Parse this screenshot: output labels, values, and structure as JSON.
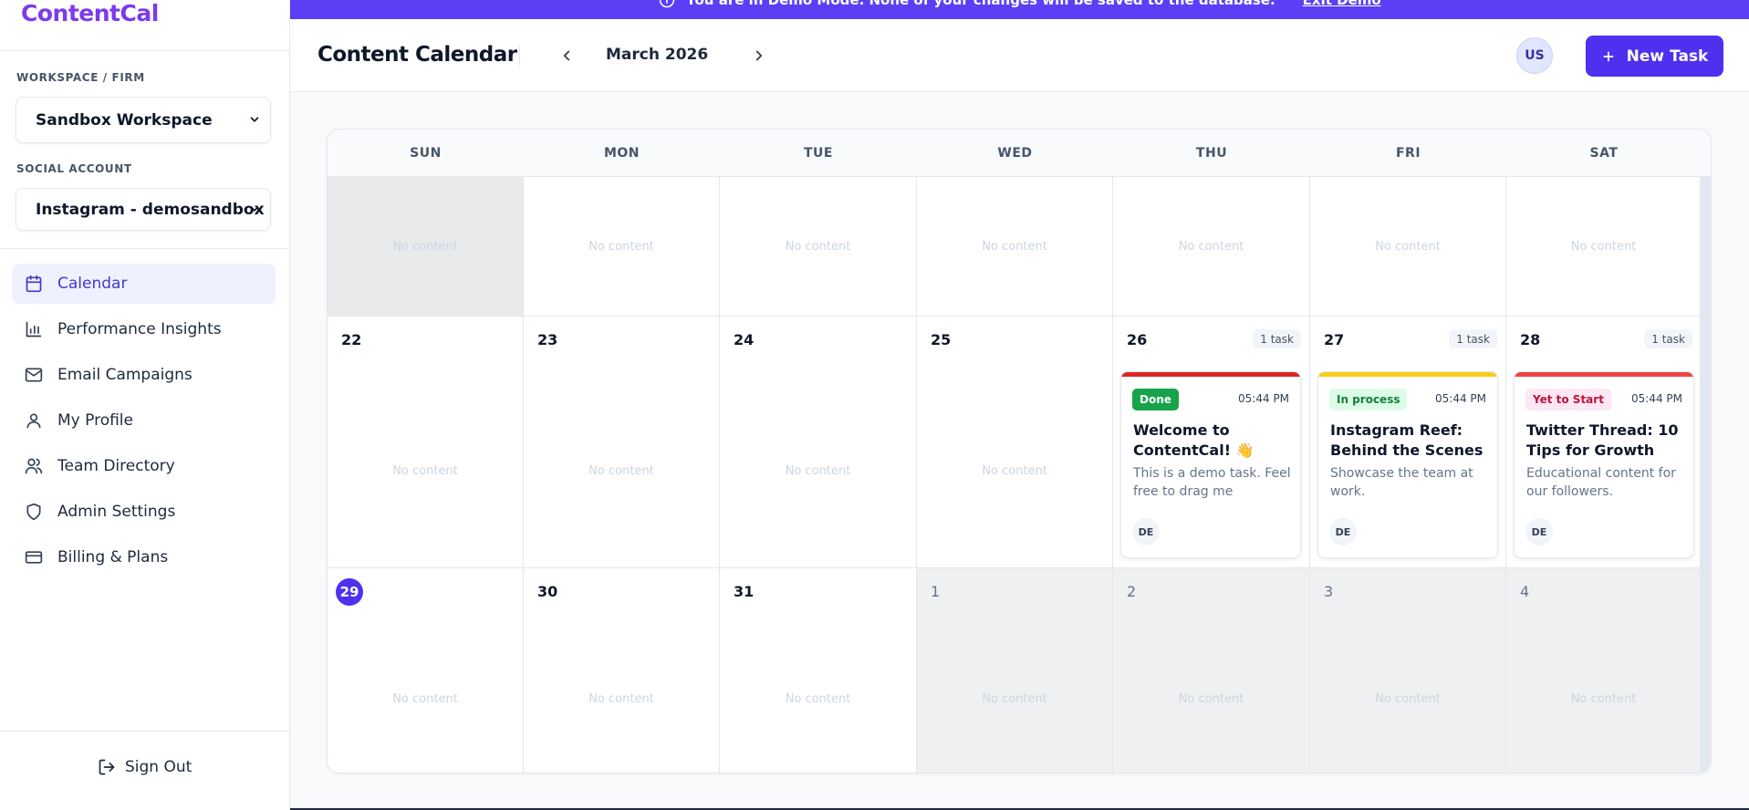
{
  "app": {
    "brand": "ContentCal"
  },
  "sidebar": {
    "workspace_label": "WORKSPACE / FIRM",
    "workspace_value": "Sandbox Workspace",
    "account_label": "SOCIAL ACCOUNT",
    "account_value": "Instagram - demosandbox",
    "items": [
      {
        "label": "Calendar",
        "icon": "calendar-icon",
        "active": true
      },
      {
        "label": "Performance Insights",
        "icon": "bar-chart-icon",
        "active": false
      },
      {
        "label": "Email Campaigns",
        "icon": "mail-icon",
        "active": false
      },
      {
        "label": "My Profile",
        "icon": "user-icon",
        "active": false
      },
      {
        "label": "Team Directory",
        "icon": "users-icon",
        "active": false
      },
      {
        "label": "Admin Settings",
        "icon": "shield-icon",
        "active": false
      },
      {
        "label": "Billing & Plans",
        "icon": "credit-card-icon",
        "active": false
      }
    ],
    "sign_out": "Sign Out"
  },
  "banner": {
    "message": "You are in Demo Mode. None of your changes will be saved to the database.",
    "exit_link": "Exit Demo"
  },
  "header": {
    "title": "Content Calendar",
    "month": "March 2026",
    "user_initials": "US",
    "new_task": "New Task"
  },
  "calendar": {
    "weekdays": [
      "SUN",
      "MON",
      "TUE",
      "WED",
      "THU",
      "FRI",
      "SAT"
    ],
    "empty_text": "No content",
    "week2_days": [
      "22",
      "23",
      "24",
      "25",
      "26",
      "27",
      "28"
    ],
    "week3_days": [
      "29",
      "30",
      "31",
      "1",
      "2",
      "3",
      "4"
    ],
    "today": "29",
    "task_count_label": "1 task",
    "tasks": [
      {
        "day": "26",
        "status": "Done",
        "status_color": "#16a34a",
        "stripe_color": "#dc2626",
        "time": "05:44 PM",
        "title": "Welcome to ContentCal! 👋",
        "description": "This is a demo task. Feel free to drag me around...",
        "assignee": "DE"
      },
      {
        "day": "27",
        "status": "In process",
        "status_color": "#dcfce7",
        "stripe_color": "#facc15",
        "time": "05:44 PM",
        "title": "Instagram Reef: Behind the Scenes",
        "description": "Showcase the team at work.",
        "assignee": "DE"
      },
      {
        "day": "28",
        "status": "Yet to Start",
        "status_color": "#fce7f3",
        "stripe_color": "#ef4444",
        "time": "05:44 PM",
        "title": "Twitter Thread: 10 Tips for Growth",
        "description": "Educational content for our followers.",
        "assignee": "DE"
      }
    ]
  },
  "colors": {
    "accent": "#4f2ff0",
    "brand": "#7c3aed",
    "banner": "#5b3ff5"
  }
}
